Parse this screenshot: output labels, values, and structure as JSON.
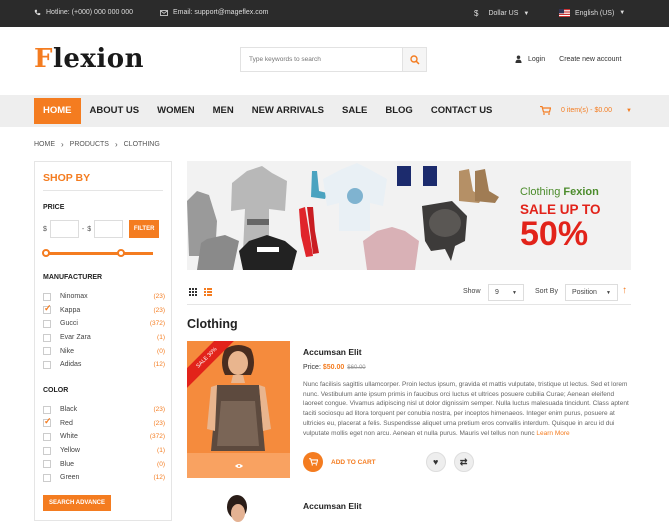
{
  "topbar": {
    "hotline": "Hotline: (+000) 000 000 000",
    "email": "Email: support@mageflex.com",
    "currency": "Dollar US",
    "language": "English (US)"
  },
  "header": {
    "logo_first": "F",
    "logo_rest": "lexion",
    "search_placeholder": "Type keywords to search",
    "login": "Login",
    "create_account": "Create new account"
  },
  "nav": {
    "items": [
      "HOME",
      "ABOUT US",
      "WOMEN",
      "MEN",
      "NEW ARRIVALS",
      "SALE",
      "BLOG",
      "CONTACT US"
    ],
    "cart": "0 item(s) - $0.00"
  },
  "breadcrumb": [
    "HOME",
    "PRODUCTS",
    "CLOTHING"
  ],
  "sidebar": {
    "title": "SHOP BY",
    "price_label": "PRICE",
    "currency_symbol": "$",
    "dash": "-",
    "filter_button": "FILTER",
    "manufacturer_label": "MANUFACTURER",
    "manufacturers": [
      {
        "name": "Ninomax",
        "count": "(23)",
        "checked": false
      },
      {
        "name": "Kappa",
        "count": "(23)",
        "checked": true
      },
      {
        "name": "Gucci",
        "count": "(372)",
        "checked": false
      },
      {
        "name": "Evar Zara",
        "count": "(1)",
        "checked": false
      },
      {
        "name": "Nike",
        "count": "(0)",
        "checked": false
      },
      {
        "name": "Adidas",
        "count": "(12)",
        "checked": false
      }
    ],
    "color_label": "COLOR",
    "colors": [
      {
        "name": "Black",
        "count": "(23)",
        "checked": false
      },
      {
        "name": "Red",
        "count": "(23)",
        "checked": true
      },
      {
        "name": "White",
        "count": "(372)",
        "checked": false
      },
      {
        "name": "Yellow",
        "count": "(1)",
        "checked": false
      },
      {
        "name": "Blue",
        "count": "(0)",
        "checked": false
      },
      {
        "name": "Green",
        "count": "(12)",
        "checked": false
      }
    ],
    "advance_button": "SEARCH ADVANCE"
  },
  "banner": {
    "line1_a": "Clothing ",
    "line1_b": "Fexion",
    "line2": "SALE UP TO",
    "line3": "50%"
  },
  "toolbar": {
    "show_label": "Show",
    "show_value": "9",
    "sort_label": "Sort By",
    "sort_value": "Position"
  },
  "category_title": "Clothing",
  "products": [
    {
      "name": "Accumsan Elit",
      "sale_tag": "SALE 30%",
      "price_label": "Price:",
      "price": "$50.00",
      "old_price": "$60.00",
      "description": "Nunc facilisis sagittis ullamcorper. Proin lectus ipsum, gravida et mattis vulputate, tristique ut lectus. Sed et lorem nunc. Vestibulum ante ipsum primis in faucibus orci luctus et ultrices posuere cubilia Curae; Aenean eleifend laoreet congue. Vivamus adipiscing nisl ut dolor dignissim semper. Nulla luctus malesuada tincidunt. Class aptent taciti sociosqu ad litora torquent per conubia nostra, per inceptos himenaeos. Integer enim purus, posuere at ultricies eu, placerat a felis. Suspendisse aliquet urna pretium eros convallis interdum. Quisque in arcu id dui vulputate mollis eget non arcu. Aenean et nulla purus. Mauris vel tellus non nunc ",
      "learn_more": "Learn More",
      "add_to_cart": "ADD TO CART"
    },
    {
      "name": "Accumsan Elit"
    }
  ]
}
